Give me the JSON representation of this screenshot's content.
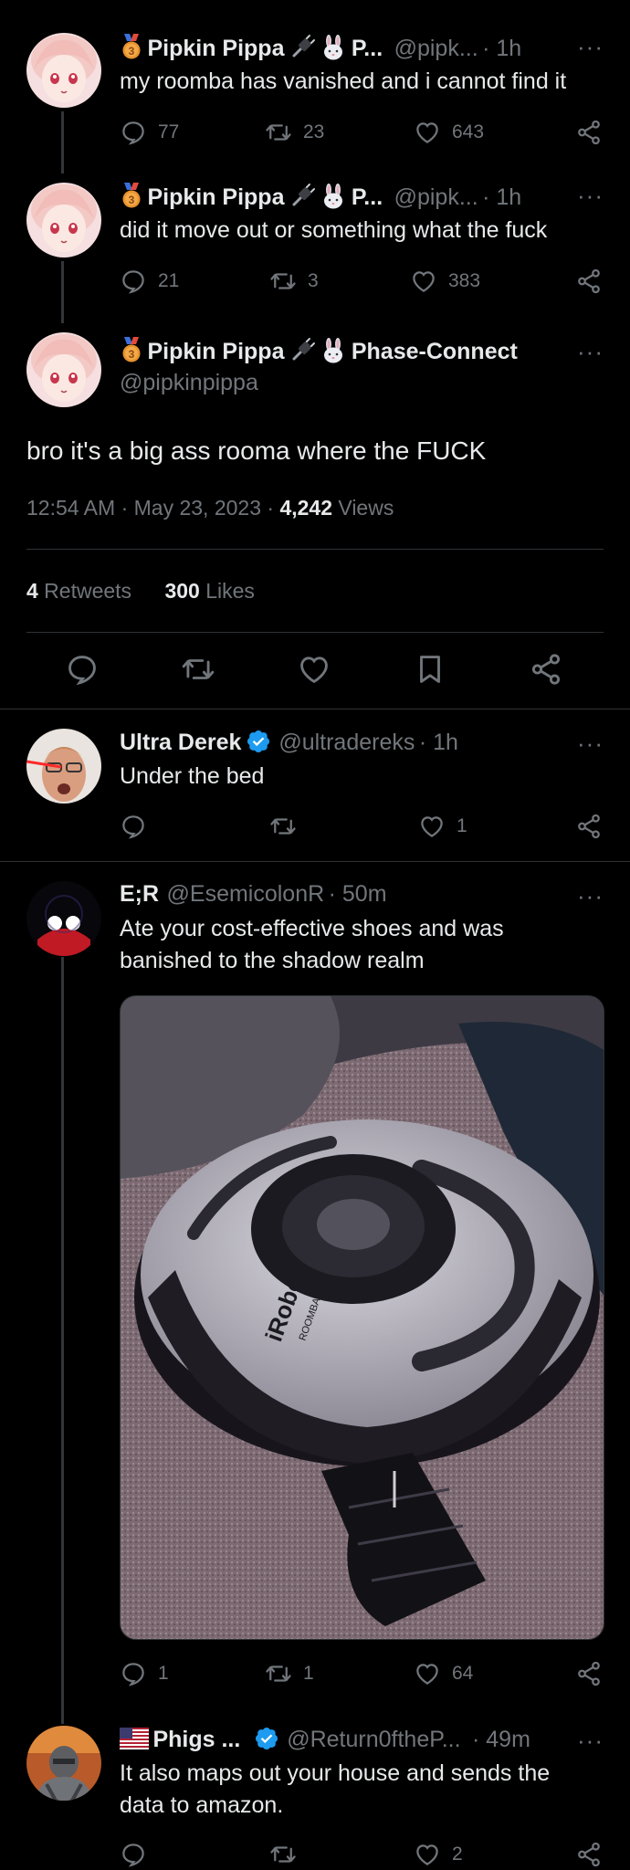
{
  "tweets": [
    {
      "name": "Pipkin Pippa",
      "name_suffix": "P...",
      "handle": "@pipk...",
      "time": "· 1h",
      "text": "my roomba has vanished and i cannot find it",
      "replies": "77",
      "retweets": "23",
      "likes": "643"
    },
    {
      "name": "Pipkin Pippa",
      "name_suffix": "P...",
      "handle": "@pipk...",
      "time": "· 1h",
      "text": "did it move out or something what the fuck",
      "replies": "21",
      "retweets": "3",
      "likes": "383"
    }
  ],
  "main": {
    "name": "Pipkin Pippa",
    "name_suffix": "Phase-Connect",
    "handle": "@pipkinpippa",
    "text": "bro it's a big ass rooma where the FUCK",
    "timestamp": "12:54 AM · May 23, 2023 · ",
    "views_count": "4,242",
    "views_label": " Views",
    "retweets_count": "4",
    "retweets_label": " Retweets",
    "likes_count": "300",
    "likes_label": " Likes"
  },
  "replies": [
    {
      "name": "Ultra Derek",
      "handle": "@ultradereks",
      "time": "· 1h",
      "text": "Under the bed",
      "replies": "",
      "retweets": "",
      "likes": "1"
    },
    {
      "name": "E;R",
      "handle": "@EsemicolonR",
      "time": "· 50m",
      "text": "Ate your cost-effective shoes and was banished to the shadow realm",
      "replies": "1",
      "retweets": "1",
      "likes": "64",
      "image_brand": "iRobot",
      "image_model": "ROOMBA"
    },
    {
      "name": "Phigs ...",
      "handle": "@Return0ftheP...",
      "time": "· 49m",
      "text": "It also maps out your house and sends the data to amazon.",
      "replies": "",
      "retweets": "",
      "likes": "2"
    }
  ],
  "colors": {
    "background": "#000000",
    "text": "#e7e9ea",
    "muted": "#71767b",
    "divider": "#2f3336",
    "verified": "#1d9bf0"
  }
}
